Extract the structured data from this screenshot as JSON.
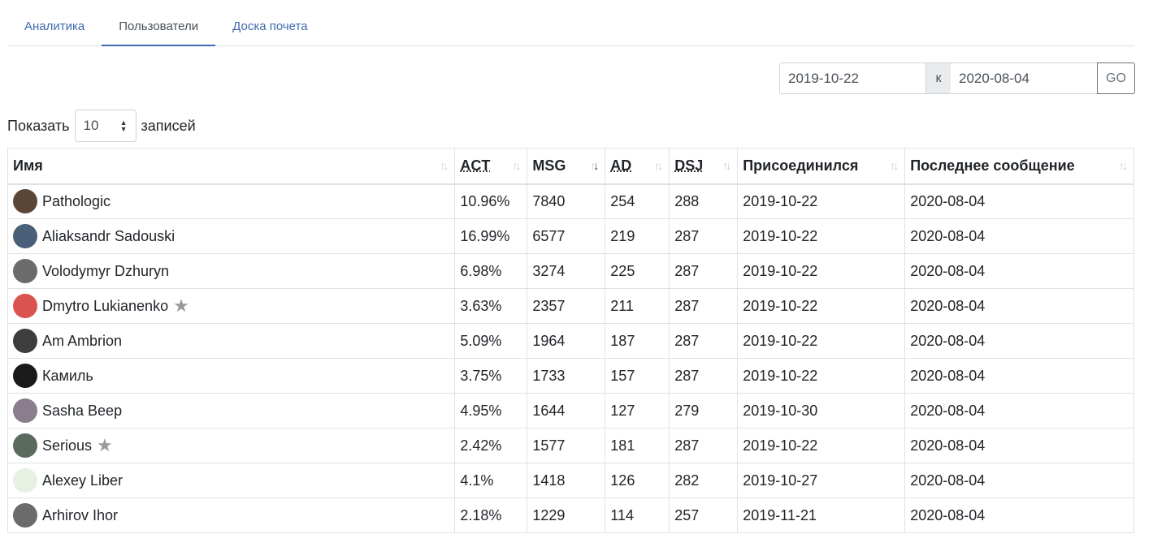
{
  "tabs": [
    {
      "label": "Аналитика",
      "active": false
    },
    {
      "label": "Пользователи",
      "active": true
    },
    {
      "label": "Доска почета",
      "active": false
    }
  ],
  "date_range": {
    "from": "2019-10-22",
    "separator": "к",
    "to": "2020-08-04",
    "go_label": "GO"
  },
  "length": {
    "prefix": "Показать",
    "value": "10",
    "suffix": "записей"
  },
  "table": {
    "columns": [
      {
        "label": "Имя",
        "abbr": false,
        "sort_icon": "sort-both-icon"
      },
      {
        "label": "ACT",
        "abbr": true,
        "sort_icon": "sort-both-icon"
      },
      {
        "label": "MSG",
        "abbr": false,
        "sort_icon": "sort-desc-icon"
      },
      {
        "label": "AD",
        "abbr": true,
        "sort_icon": "sort-both-icon"
      },
      {
        "label": "DSJ",
        "abbr": true,
        "sort_icon": "sort-both-icon"
      },
      {
        "label": "Присоединился",
        "abbr": false,
        "sort_icon": "sort-both-icon"
      },
      {
        "label": "Последнее сообщение",
        "abbr": false,
        "sort_icon": "sort-both-icon"
      }
    ],
    "rows": [
      {
        "name": "Pathologic",
        "star": false,
        "avatar": "#5b4636",
        "act": "10.96%",
        "msg": "7840",
        "ad": "254",
        "dsj": "288",
        "joined": "2019-10-22",
        "last": "2020-08-04"
      },
      {
        "name": "Aliaksandr Sadouski",
        "star": false,
        "avatar": "#4a6078",
        "act": "16.99%",
        "msg": "6577",
        "ad": "219",
        "dsj": "287",
        "joined": "2019-10-22",
        "last": "2020-08-04"
      },
      {
        "name": "Volodymyr Dzhuryn",
        "star": false,
        "avatar": "#6b6b6b",
        "act": "6.98%",
        "msg": "3274",
        "ad": "225",
        "dsj": "287",
        "joined": "2019-10-22",
        "last": "2020-08-04"
      },
      {
        "name": "Dmytro Lukianenko",
        "star": true,
        "avatar": "#d9534f",
        "act": "3.63%",
        "msg": "2357",
        "ad": "211",
        "dsj": "287",
        "joined": "2019-10-22",
        "last": "2020-08-04"
      },
      {
        "name": "Am Ambrion",
        "star": false,
        "avatar": "#3d3d3d",
        "act": "5.09%",
        "msg": "1964",
        "ad": "187",
        "dsj": "287",
        "joined": "2019-10-22",
        "last": "2020-08-04"
      },
      {
        "name": "Камиль",
        "star": false,
        "avatar": "#1a1a1a",
        "act": "3.75%",
        "msg": "1733",
        "ad": "157",
        "dsj": "287",
        "joined": "2019-10-22",
        "last": "2020-08-04"
      },
      {
        "name": "Sasha Beep",
        "star": false,
        "avatar": "#8a7d8c",
        "act": "4.95%",
        "msg": "1644",
        "ad": "127",
        "dsj": "279",
        "joined": "2019-10-30",
        "last": "2020-08-04"
      },
      {
        "name": "Serious",
        "star": true,
        "avatar": "#5a6b5e",
        "act": "2.42%",
        "msg": "1577",
        "ad": "181",
        "dsj": "287",
        "joined": "2019-10-22",
        "last": "2020-08-04"
      },
      {
        "name": "Alexey Liber",
        "star": false,
        "avatar": "#e8f0e4",
        "act": "4.1%",
        "msg": "1418",
        "ad": "126",
        "dsj": "282",
        "joined": "2019-10-27",
        "last": "2020-08-04"
      },
      {
        "name": "Arhirov Ihor",
        "star": false,
        "avatar": "#6b6b6b",
        "act": "2.18%",
        "msg": "1229",
        "ad": "114",
        "dsj": "257",
        "joined": "2019-11-21",
        "last": "2020-08-04"
      }
    ]
  }
}
